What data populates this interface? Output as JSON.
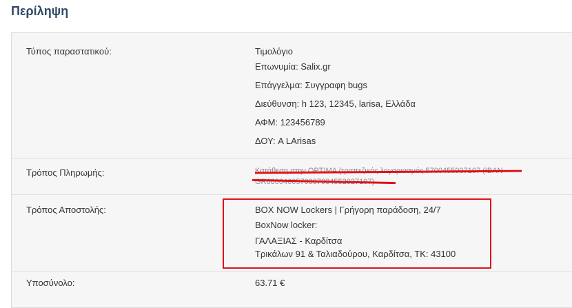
{
  "page": {
    "title": "Περίληψη"
  },
  "document_type": {
    "label": "Τύπος παραστατικού:",
    "values": [
      "Τιμολόγιο",
      "Επωνυμία: Salix.gr",
      "Επάγγελμα: Συγγραφη bugs",
      "Διεύθυνση: h 123, 12345, larisa, Ελλάδα",
      "ΑΦΜ: 123456789",
      "ΔΟΥ: A LArisas"
    ]
  },
  "payment": {
    "label": "Τρόπος Πληρωμής:",
    "struck_lines": [
      "Κατάθεση στην OPTIMA (τραπεζικός λογαριασμός 5700455907107 (IBAN",
      "GR6800460570007004552027197)"
    ]
  },
  "shipping": {
    "label": "Τρόπος Αποστολής:",
    "values": [
      "BOX NOW Lockers | Γρήγορη παράδοση, 24/7",
      "BoxNow locker:",
      "ΓΑΛΑΞΙΑΣ - Καρδίτσα",
      "Τρικάλων 91 & Ταλιαδούρου, Καρδίτσα, ΤΚ: 43100"
    ]
  },
  "subtotal": {
    "label": "Υποσύνολο:",
    "value": "63.71 €"
  },
  "colors": {
    "title": "#2f4a66",
    "annotation_red": "#e0121b",
    "panel_bg": "#f6f6f6"
  }
}
